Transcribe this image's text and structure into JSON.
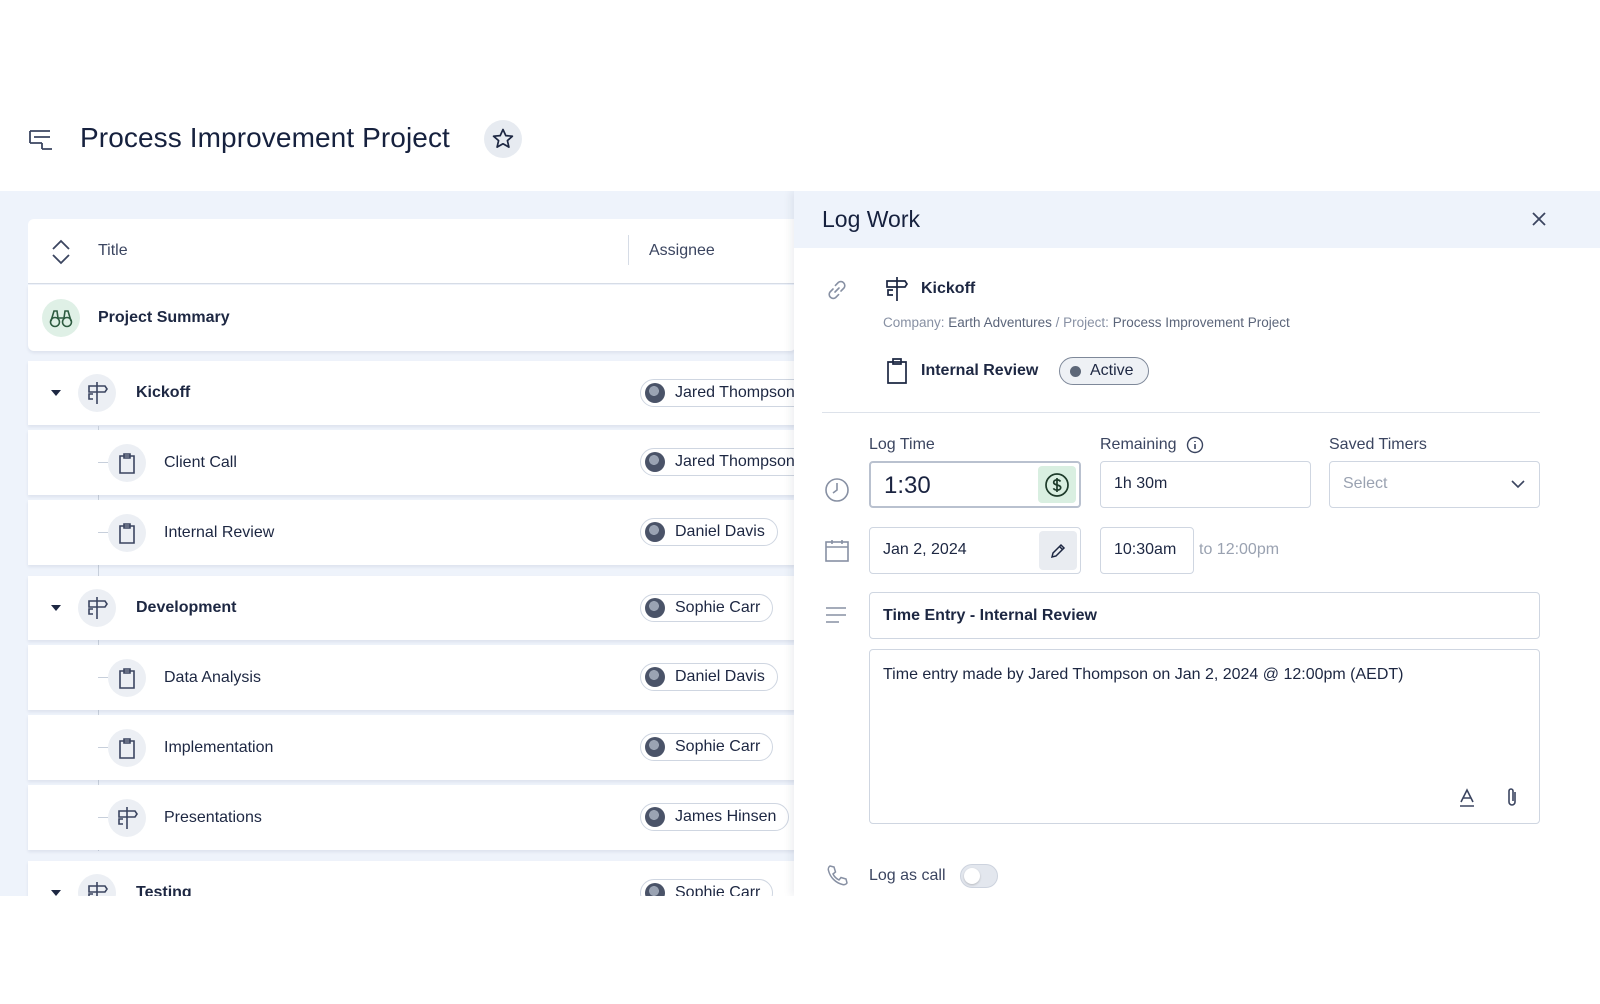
{
  "header": {
    "title": "Process Improvement Project"
  },
  "table": {
    "columns": {
      "title": "Title",
      "assignee": "Assignee"
    },
    "summary_label": "Project Summary",
    "rows": [
      {
        "label": "Kickoff",
        "assignee": "Jared Thompson",
        "type": "group"
      },
      {
        "label": "Client Call",
        "assignee": "Jared Thompson",
        "type": "task"
      },
      {
        "label": "Internal Review",
        "assignee": "Daniel Davis",
        "type": "task"
      },
      {
        "label": "Development",
        "assignee": "Sophie Carr",
        "type": "group"
      },
      {
        "label": "Data Analysis",
        "assignee": "Daniel Davis",
        "type": "task"
      },
      {
        "label": "Implementation",
        "assignee": "Sophie Carr",
        "type": "task"
      },
      {
        "label": "Presentations",
        "assignee": "James Hinsen",
        "type": "milestone"
      },
      {
        "label": "Testing",
        "assignee": "Sophie Carr",
        "type": "group"
      }
    ]
  },
  "panel": {
    "title": "Log Work",
    "parent_label": "Kickoff",
    "breadcrumb": {
      "company_prefix": "Company:",
      "company": "Earth Adventures",
      "separator": " / ",
      "project_prefix": "Project:",
      "project": "Process Improvement Project"
    },
    "task_label": "Internal Review",
    "status": "Active",
    "fields": {
      "log_time_label": "Log Time",
      "log_time_value": "1:30",
      "remaining_label": "Remaining",
      "remaining_value": "1h 30m",
      "saved_timers_label": "Saved Timers",
      "saved_timers_placeholder": "Select",
      "date_value": "Jan 2, 2024",
      "start_time": "10:30am",
      "end_time_text": "to 12:00pm",
      "entry_title": "Time Entry - Internal Review",
      "description": "Time entry made by Jared Thompson on Jan 2, 2024 @ 12:00pm (AEDT)",
      "log_as_call_label": "Log as call"
    }
  },
  "colors": {
    "accent_green_bg": "#d9efe1",
    "main_bg": "#eef3fb",
    "text_dark": "#16213e"
  }
}
